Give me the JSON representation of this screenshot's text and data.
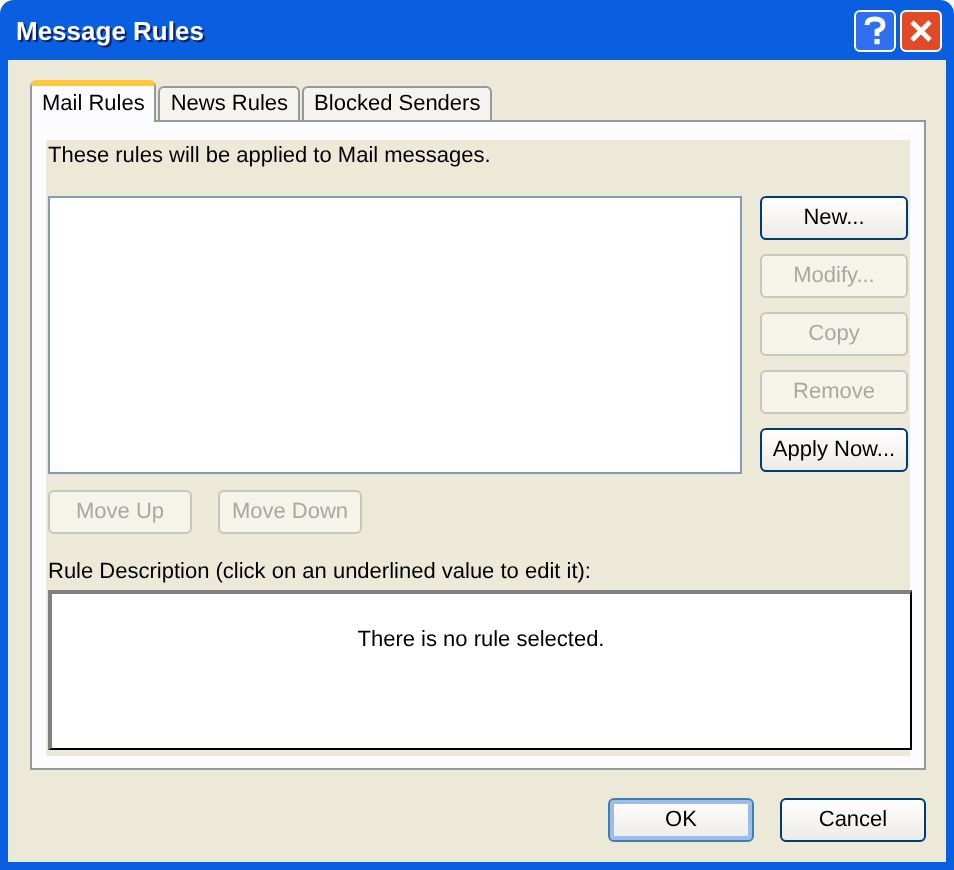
{
  "window": {
    "title": "Message Rules"
  },
  "tabs": [
    {
      "label": "Mail Rules",
      "selected": true
    },
    {
      "label": "News Rules",
      "selected": false
    },
    {
      "label": "Blocked Senders",
      "selected": false
    }
  ],
  "intro": "These rules will be applied to Mail messages.",
  "side_buttons": [
    {
      "label": "New...",
      "disabled": false
    },
    {
      "label": "Modify...",
      "disabled": true
    },
    {
      "label": "Copy",
      "disabled": true
    },
    {
      "label": "Remove",
      "disabled": true
    },
    {
      "label": "Apply Now...",
      "disabled": false
    }
  ],
  "move_buttons": [
    {
      "label": "Move Up",
      "disabled": true
    },
    {
      "label": "Move Down",
      "disabled": true
    }
  ],
  "description": {
    "label": "Rule Description (click on an underlined value to edit it):",
    "text": "There is no rule selected."
  },
  "dialog_buttons": [
    {
      "label": "OK",
      "default": true
    },
    {
      "label": "Cancel",
      "default": false
    }
  ]
}
